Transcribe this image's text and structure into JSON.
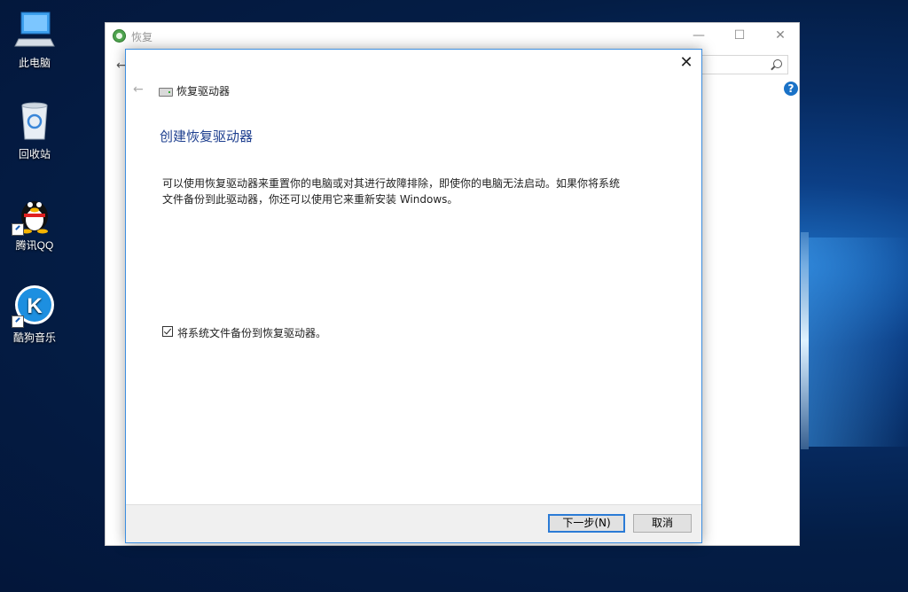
{
  "desktop": {
    "icons": [
      {
        "label": "此电脑",
        "icon": "computer-icon"
      },
      {
        "label": "回收站",
        "icon": "recycle-bin-icon"
      },
      {
        "label": "腾讯QQ",
        "icon": "qq-icon"
      },
      {
        "label": "酷狗音乐",
        "icon": "kugou-icon"
      }
    ]
  },
  "bg_window": {
    "title": "恢复",
    "controls": {
      "minimize": "—",
      "maximize": "☐",
      "close": "✕"
    },
    "back_glyph": "←",
    "help_glyph": "?"
  },
  "dialog": {
    "close_glyph": "✕",
    "back_glyph": "←",
    "breadcrumb": "恢复驱动器",
    "heading": "创建恢复驱动器",
    "description": "可以使用恢复驱动器来重置你的电脑或对其进行故障排除，即使你的电脑无法启动。如果你将系统文件备份到此驱动器，你还可以使用它来重新安装 Windows。",
    "checkbox": {
      "label": "将系统文件备份到恢复驱动器。",
      "checked": true
    },
    "buttons": {
      "next": "下一步(N)",
      "cancel": "取消"
    }
  },
  "colors": {
    "accent": "#2b7bd6",
    "heading": "#1e3f8f",
    "help": "#1a72c7"
  }
}
